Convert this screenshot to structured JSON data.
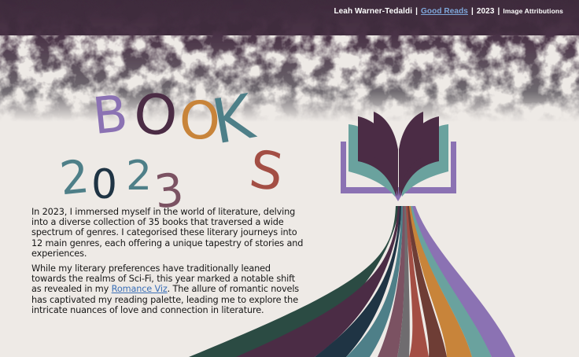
{
  "header": {
    "author": "Leah Warner-Tedaldi",
    "link_label": "Good Reads",
    "year": "2023",
    "attributions": "Image Attributions",
    "separator": "|"
  },
  "title": {
    "word_letters": [
      "B",
      "O",
      "O",
      "K",
      "S"
    ],
    "year_letters": [
      "2",
      "0",
      "2",
      "3"
    ]
  },
  "intro": {
    "paragraph1": "In 2023, I immersed myself in the world of literature, delving into a diverse collection of 35 books that traversed a wide spectrum of genres. I categorised these literary journeys into 12 main genres, each offering a unique tapestry of stories and experiences.",
    "paragraph2_before": "While my literary preferences have traditionally leaned towards the realms of Sci-Fi, this year marked a notable shift as revealed in my ",
    "paragraph2_link": "Romance Viz",
    "paragraph2_after": ". The allure of romantic novels has captivated my reading palette, leading me to explore the intricate nuances of love and connection in literature."
  },
  "colors": {
    "background": "#eeeae6",
    "header_band": "#4a3347",
    "purple_lavender": "#8b72b3",
    "plum": "#4b2c45",
    "orange": "#c8843a",
    "teal": "#4e7f88",
    "rust": "#a34e44",
    "navy": "#1f3444",
    "mauve": "#7b5262",
    "sea_green": "#6aa29e",
    "forest": "#2b4b43"
  },
  "icons": [
    "open-book-icon",
    "stream-ribbons"
  ]
}
